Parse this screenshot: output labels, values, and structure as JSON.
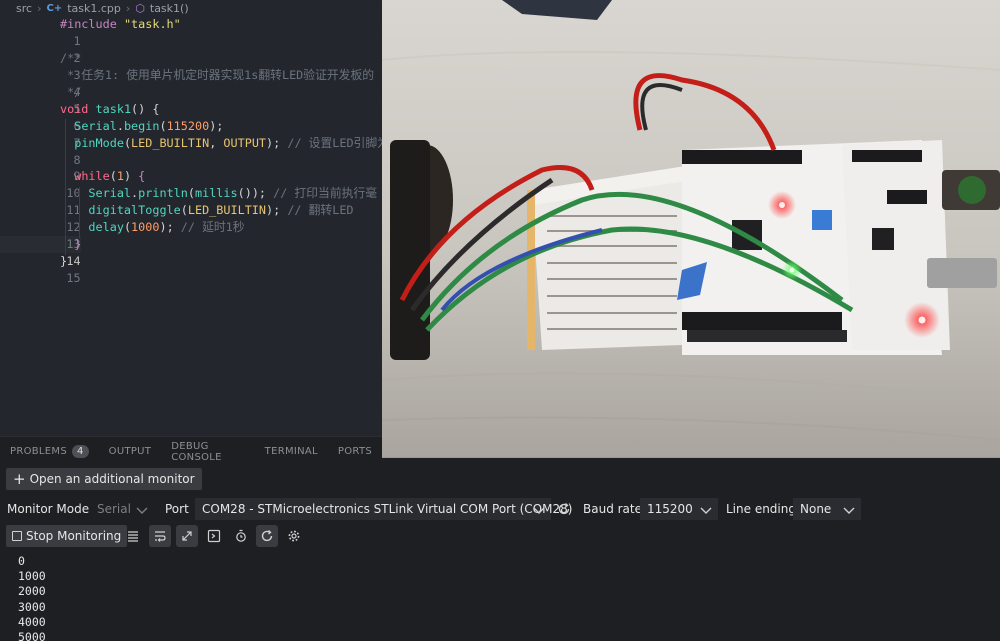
{
  "breadcrumb": {
    "folder": "src",
    "file": "task1.cpp",
    "symbol": "task1()"
  },
  "code": {
    "lines": [
      {
        "n": "1"
      },
      {
        "n": "2"
      },
      {
        "n": "3"
      },
      {
        "n": "4"
      },
      {
        "n": "5"
      },
      {
        "n": "6"
      },
      {
        "n": "7"
      },
      {
        "n": "8"
      },
      {
        "n": "9"
      },
      {
        "n": "10"
      },
      {
        "n": "11"
      },
      {
        "n": "12"
      },
      {
        "n": "13"
      },
      {
        "n": "14"
      },
      {
        "n": "15"
      }
    ],
    "include_kw": "#include",
    "include_file": "\"task.h\"",
    "doc_open": "/**",
    "doc_text": " * 任务1: 使用单片机定时器实现1s翻转LED验证开发板的",
    "doc_close": " */",
    "void_kw": "void",
    "fn_name": "task1",
    "fn_sig": "() {",
    "serial_obj": "Serial",
    "begin_fn": "begin",
    "baud_num": "115200",
    "pinmode_fn": "pinMode",
    "led_builtin": "LED_BUILTIN",
    "output_const": "OUTPUT",
    "comment_pin": "// 设置LED引脚为",
    "while_kw": "while",
    "while_num": "1",
    "println_fn": "println",
    "millis_fn": "millis",
    "comment_print": "// 打印当前执行毫",
    "toggle_fn": "digitalToggle",
    "comment_toggle": "// 翻转LED",
    "delay_fn": "delay",
    "delay_num": "1000",
    "comment_delay": "// 延时1秒"
  },
  "panel": {
    "tabs": [
      {
        "label": "PROBLEMS",
        "badge": "4"
      },
      {
        "label": "OUTPUT"
      },
      {
        "label": "DEBUG CONSOLE"
      },
      {
        "label": "TERMINAL"
      },
      {
        "label": "PORTS"
      }
    ]
  },
  "monitor": {
    "open_button": "Open an additional monitor",
    "mode_label": "Monitor Mode",
    "mode_value": "Serial",
    "port_label": "Port",
    "port_value": "COM28 - STMicroelectronics STLink Virtual COM Port (COM28)",
    "baud_label": "Baud rate",
    "baud_value": "115200",
    "line_ending_label": "Line ending",
    "line_ending_value": "None",
    "stop_button": "Stop Monitoring",
    "output": [
      "0",
      "1000",
      "2000",
      "3000",
      "4000",
      "5000"
    ]
  },
  "icons": {
    "refresh": "refresh-icon",
    "wrap": "word-wrap-icon",
    "autoscroll": "auto-scroll-icon",
    "timestamp": "timestamp-icon",
    "terminal": "terminal-icon",
    "clear": "clear-output-icon",
    "settings": "gear-icon"
  },
  "colors": {
    "editor_bg": "#24262e",
    "panel_bg": "#1e1f22",
    "keyword": "#ff6b8b",
    "function": "#4fd6be",
    "number": "#ff9e64",
    "string": "#e6db74"
  }
}
